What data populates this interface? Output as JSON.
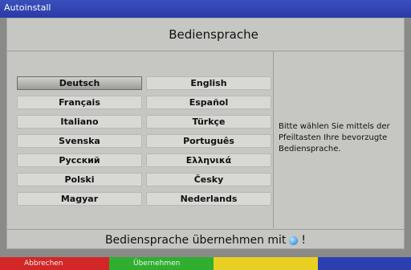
{
  "window": {
    "title": "Autoinstall"
  },
  "header": {
    "title": "Bediensprache"
  },
  "languages": {
    "left": [
      "Deutsch",
      "Français",
      "Italiano",
      "Svenska",
      "Русский",
      "Polski",
      "Magyar"
    ],
    "right": [
      "English",
      "Español",
      "Türkçe",
      "Português",
      "Ελληνικά",
      "Česky",
      "Nederlands"
    ],
    "selected": "Deutsch"
  },
  "info": {
    "text": "Bitte wählen Sie mittels der Pfeiltasten Ihre bevorzugte Bediensprache."
  },
  "footer": {
    "prefix": "Bediensprache übernehmen mit",
    "suffix": "!",
    "ok_icon": "ok-button-icon"
  },
  "colorbar": {
    "red_label": "Abbrechen",
    "green_label": "Übernehmen",
    "colors": {
      "red": "#d32626",
      "green": "#2fae2f",
      "yellow": "#e8d023",
      "blue": "#2b3fb0"
    }
  }
}
